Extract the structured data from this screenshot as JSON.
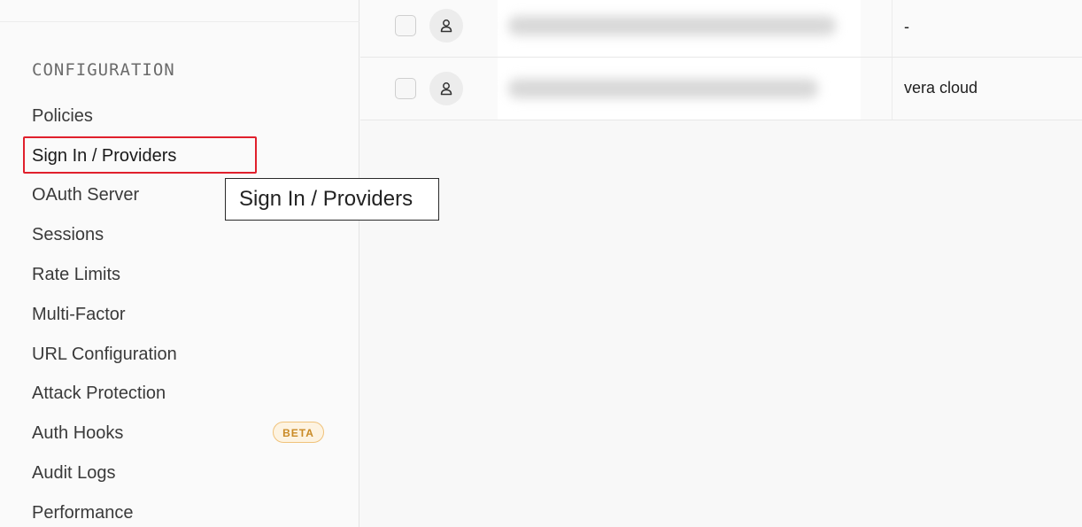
{
  "sidebar": {
    "section_title": "CONFIGURATION",
    "items": [
      {
        "label": "Policies"
      },
      {
        "label": "Sign In / Providers"
      },
      {
        "label": "OAuth Server"
      },
      {
        "label": "Sessions"
      },
      {
        "label": "Rate Limits"
      },
      {
        "label": "Multi-Factor"
      },
      {
        "label": "URL Configuration"
      },
      {
        "label": "Attack Protection"
      },
      {
        "label": "Auth Hooks",
        "badge": "BETA"
      },
      {
        "label": "Audit Logs"
      },
      {
        "label": "Performance"
      }
    ],
    "active_item": "Sign In / Providers"
  },
  "tooltip": {
    "text": "Sign In / Providers"
  },
  "table": {
    "rows": [
      {
        "provider": "-"
      },
      {
        "provider": "vera cloud"
      }
    ]
  },
  "icons": {
    "avatar": "user-icon",
    "checkbox": "checkbox-icon"
  },
  "colors": {
    "highlight": "#e0202c",
    "beta_text": "#c98a25",
    "beta_bg": "#fdf3e1"
  }
}
